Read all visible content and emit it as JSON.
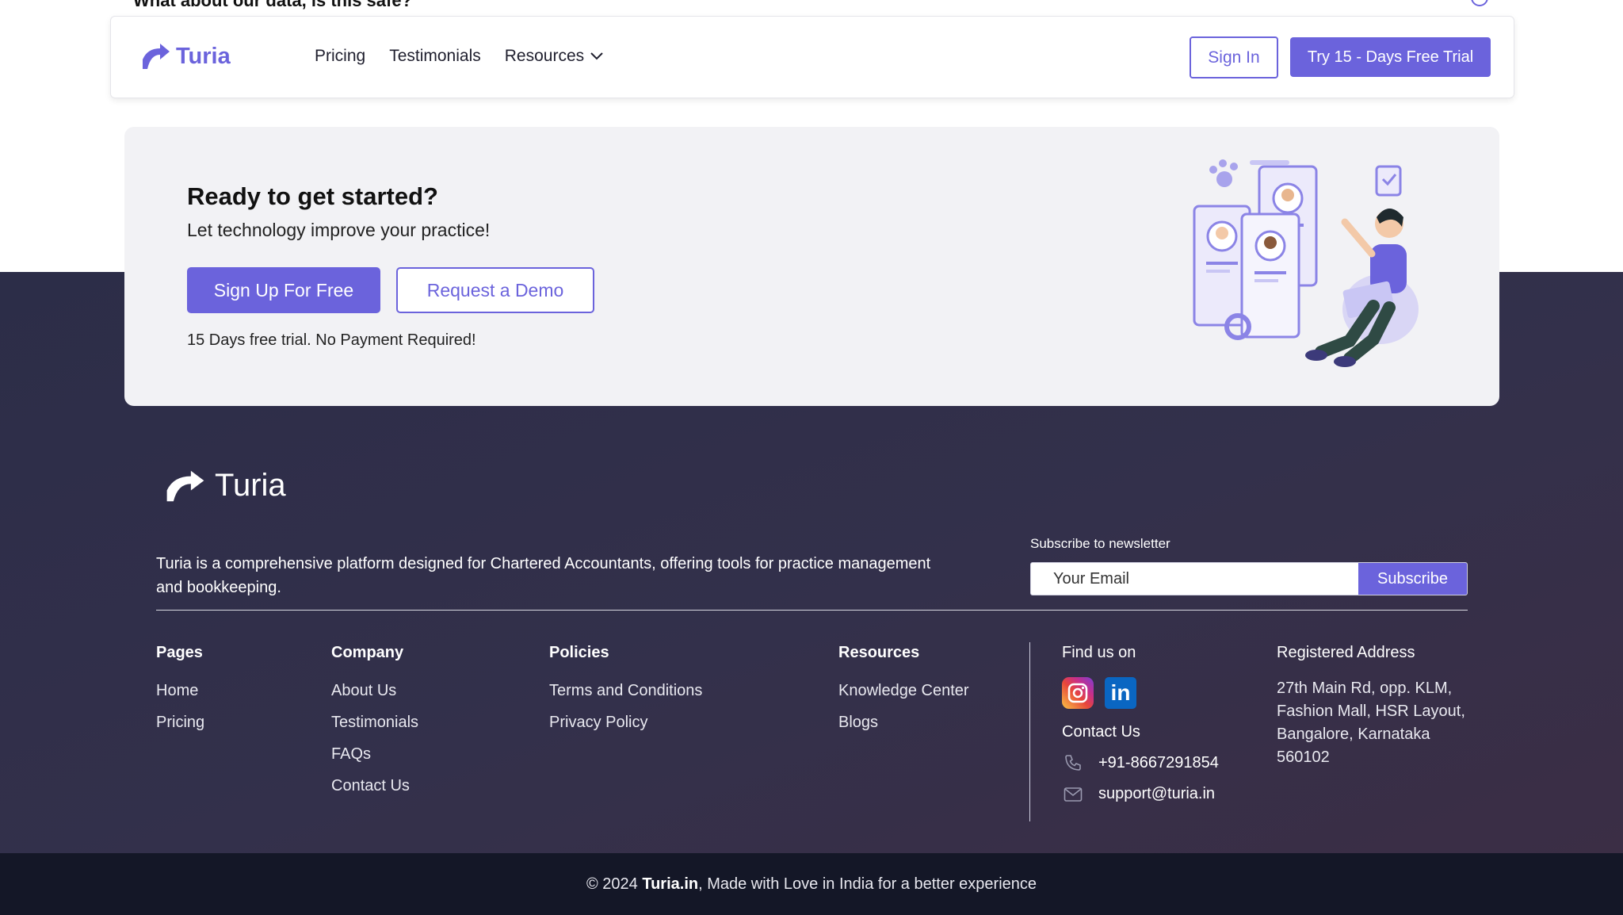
{
  "faq_peek": {
    "question": "What about our data, is this safe?"
  },
  "header": {
    "brand": "Turia",
    "nav": [
      {
        "label": "Pricing"
      },
      {
        "label": "Testimonials"
      },
      {
        "label": "Resources"
      }
    ],
    "sign_in_label": "Sign In",
    "trial_label": "Try 15 - Days Free Trial"
  },
  "cta": {
    "title": "Ready to get started?",
    "subtitle": "Let technology improve your practice!",
    "signup_label": "Sign Up For Free",
    "demo_label": "Request a Demo",
    "note": "15 Days free trial. No Payment Required!"
  },
  "footer": {
    "brand": "Turia",
    "description": "Turia is a comprehensive platform designed for Chartered Accountants, offering tools for practice management and bookkeeping.",
    "newsletter": {
      "label": "Subscribe to newsletter",
      "placeholder": "Your Email",
      "button": "Subscribe"
    },
    "columns": [
      {
        "title": "Pages",
        "links": [
          "Home",
          "Pricing"
        ]
      },
      {
        "title": "Company",
        "links": [
          "About Us",
          "Testimonials",
          "FAQs",
          "Contact Us"
        ]
      },
      {
        "title": "Policies",
        "links": [
          "Terms and Conditions",
          "Privacy Policy"
        ]
      },
      {
        "title": "Resources",
        "links": [
          "Knowledge Center",
          "Blogs"
        ]
      }
    ],
    "find_us": "Find us on",
    "social": [
      "instagram-icon",
      "linkedin-icon"
    ],
    "linkedin_glyph": "in",
    "contact_title": "Contact Us",
    "phone": "+91-8667291854",
    "email": "support@turia.in",
    "address_title": "Registered Address",
    "address": "27th Main Rd, opp. KLM, Fashion Mall, HSR Layout, Bangalore, Karnataka 560102"
  },
  "copyright": {
    "prefix": "© 2024 ",
    "brand": "Turia.in",
    "suffix": ", Made with Love in India for a better experience"
  },
  "colors": {
    "accent": "#6b63dc",
    "footer_bg": "#2c2d48",
    "bottom_bar": "#141727",
    "card_bg": "#f2f2f5"
  }
}
